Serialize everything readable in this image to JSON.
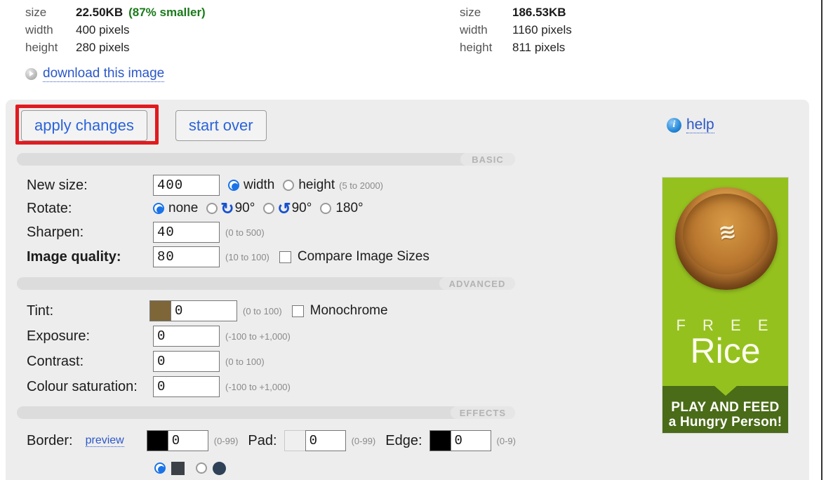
{
  "stats": {
    "left": {
      "rows": [
        {
          "key": "size",
          "value": "22.50KB",
          "note": "(87% smaller)"
        },
        {
          "key": "width",
          "value": "400 pixels"
        },
        {
          "key": "height",
          "value": "280 pixels"
        }
      ]
    },
    "right": {
      "rows": [
        {
          "key": "size",
          "value": "186.53KB"
        },
        {
          "key": "width",
          "value": "1160 pixels"
        },
        {
          "key": "height",
          "value": "811 pixels"
        }
      ]
    },
    "download_link": "download this image"
  },
  "toolbar": {
    "apply_label": "apply changes",
    "start_over_label": "start over",
    "help_label": "help",
    "help_icon_glyph": "i"
  },
  "sections": {
    "basic": "BASIC",
    "advanced": "ADVANCED",
    "effects": "EFFECTS"
  },
  "basic": {
    "new_size": {
      "label": "New size:",
      "value": "400",
      "options": [
        "width",
        "height"
      ],
      "selected": "width",
      "hint": "(5 to 2000)"
    },
    "rotate": {
      "label": "Rotate:",
      "options": [
        "none",
        "90°",
        "90°",
        "180°"
      ],
      "selected": "none",
      "icon_cw": "↻",
      "icon_ccw": "↺"
    },
    "sharpen": {
      "label": "Sharpen:",
      "value": "40",
      "hint": "(0 to 500)"
    },
    "image_quality": {
      "label": "Image quality:",
      "value": "80",
      "hint": "(10 to 100)",
      "compare_label": "Compare Image Sizes",
      "compare_checked": false
    }
  },
  "advanced": {
    "tint": {
      "label": "Tint:",
      "value": "0",
      "hint": "(0 to 100)",
      "swatch_color": "#7e6639",
      "mono_label": "Monochrome",
      "mono_checked": false
    },
    "exposure": {
      "label": "Exposure:",
      "value": "0",
      "hint": "(-100 to +1,000)"
    },
    "contrast": {
      "label": "Contrast:",
      "value": "0",
      "hint": "(0 to 100)"
    },
    "saturation": {
      "label": "Colour saturation:",
      "value": "0",
      "hint": "(-100 to +1,000)"
    }
  },
  "effects": {
    "border": {
      "label": "Border:",
      "preview_label": "preview",
      "value": "0",
      "hint": "(0-99)",
      "swatch_color": "#000000"
    },
    "pad": {
      "label": "Pad:",
      "value": "0",
      "hint": "(0-99)",
      "swatch_color": "#efefef"
    },
    "edge": {
      "label": "Edge:",
      "value": "0",
      "hint": "(0-9)",
      "swatch_color": "#000000"
    },
    "style_choices": {
      "first_selected": true,
      "square_color": "#3c4148",
      "second_selected": false,
      "circle_color": "#2e4156"
    }
  },
  "ad": {
    "free": "F R E E",
    "rice": "Rice",
    "line1": "PLAY AND FEED",
    "line2": "a Hungry Person!",
    "bg_color": "#95c11f",
    "band_color": "#4a6b18",
    "rice_glyph": "≋"
  }
}
